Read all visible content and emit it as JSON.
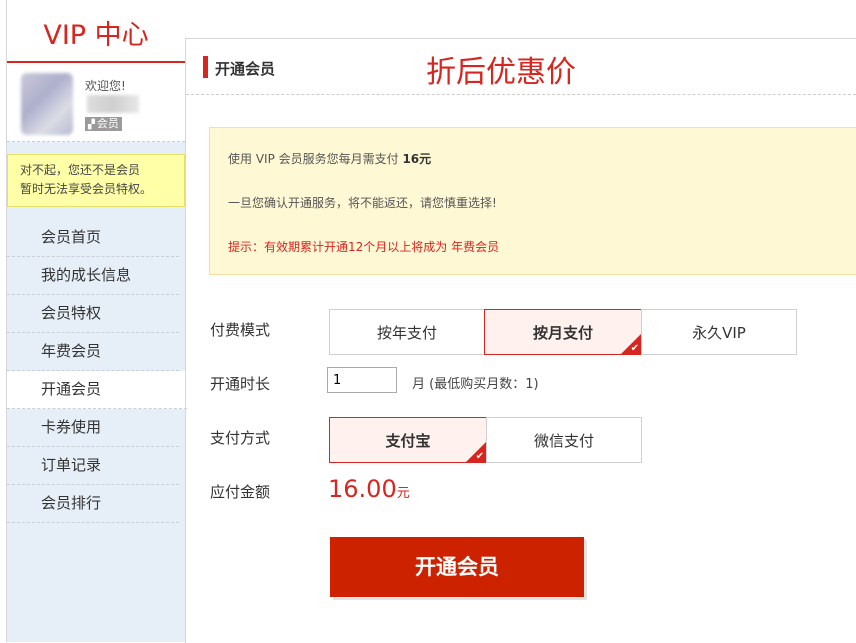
{
  "sidebar": {
    "title": "VIP 中心",
    "welcome": "欢迎您!",
    "member_tag": "会员",
    "notice_line1": "对不起，您还不是会员",
    "notice_line2": "暂时无法享受会员特权。",
    "items": [
      {
        "label": "会员首页"
      },
      {
        "label": "我的成长信息"
      },
      {
        "label": "会员特权"
      },
      {
        "label": "年费会员"
      },
      {
        "label": "开通会员"
      },
      {
        "label": "卡券使用"
      },
      {
        "label": "订单记录"
      },
      {
        "label": "会员排行"
      }
    ],
    "active_item": "开通会员"
  },
  "main": {
    "title": "开通会员",
    "promo": "折后优惠价",
    "info": {
      "line1_prefix": "使用 VIP 会员服务您每月需支付 ",
      "line1_price": "16元",
      "line2": "一旦您确认开通服务，将不能返还，请您慎重选择!",
      "line3": "提示：有效期累计开通12个月以上将成为 年费会员"
    },
    "pay_mode": {
      "label": "付费模式",
      "options": [
        "按年支付",
        "按月支付",
        "永久VIP"
      ],
      "selected": "按月支付"
    },
    "duration": {
      "label": "开通时长",
      "value": "1",
      "note": "月 (最低购买月数：1)"
    },
    "pay_method": {
      "label": "支付方式",
      "options": [
        "支付宝",
        "微信支付"
      ],
      "selected": "支付宝"
    },
    "amount": {
      "label": "应付金额",
      "value": "16.00",
      "unit": "元"
    },
    "submit_label": "开通会员"
  },
  "colors": {
    "accent": "#d7251f",
    "button": "#cc2200",
    "notice_bg": "#ffffa8",
    "info_bg": "#fff8d5",
    "sidebar_bg": "#e6eef7"
  }
}
